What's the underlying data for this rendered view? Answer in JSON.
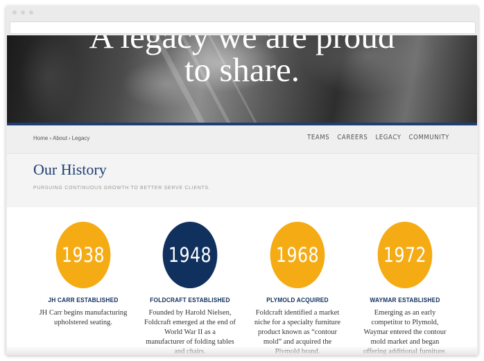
{
  "hero": {
    "title_line1": "A legacy we are proud",
    "title_line2": "to share."
  },
  "breadcrumb": {
    "items": [
      "Home",
      "About",
      "Legacy"
    ],
    "separator": "›"
  },
  "nav": {
    "items": [
      "TEAMS",
      "CAREERS",
      "LEGACY",
      "COMMUNITY"
    ]
  },
  "history": {
    "title": "Our History",
    "subtitle": "PURSUING CONTINUOUS GROWTH TO BETTER SERVE CLIENTS."
  },
  "timeline": [
    {
      "year": "1938",
      "title": "JH CARR ESTABLISHED",
      "description": "JH Carr begins manufacturing upholstered seating.",
      "color": "#f5ab14"
    },
    {
      "year": "1948",
      "title": "FOLDCRAFT ESTABLISHED",
      "description": "Founded by Harold Nielsen, Foldcraft emerged at the end of World War II as a manufacturer of folding tables and chairs.",
      "color": "#10305e"
    },
    {
      "year": "1968",
      "title": "PLYMOLD ACQUIRED",
      "description": "Foldcraft identified a market niche for a specialty furniture product known as “contour mold” and acquired the Plymold brand.",
      "color": "#f5ab14"
    },
    {
      "year": "1972",
      "title": "WAYMAR ESTABLISHED",
      "description": "Emerging as an early competitor to Plymold, Waymar entered the contour mold market and began offering additional furniture.",
      "color": "#f5ab14"
    }
  ],
  "colors": {
    "navy": "#10305e",
    "gold": "#f5ab14"
  }
}
